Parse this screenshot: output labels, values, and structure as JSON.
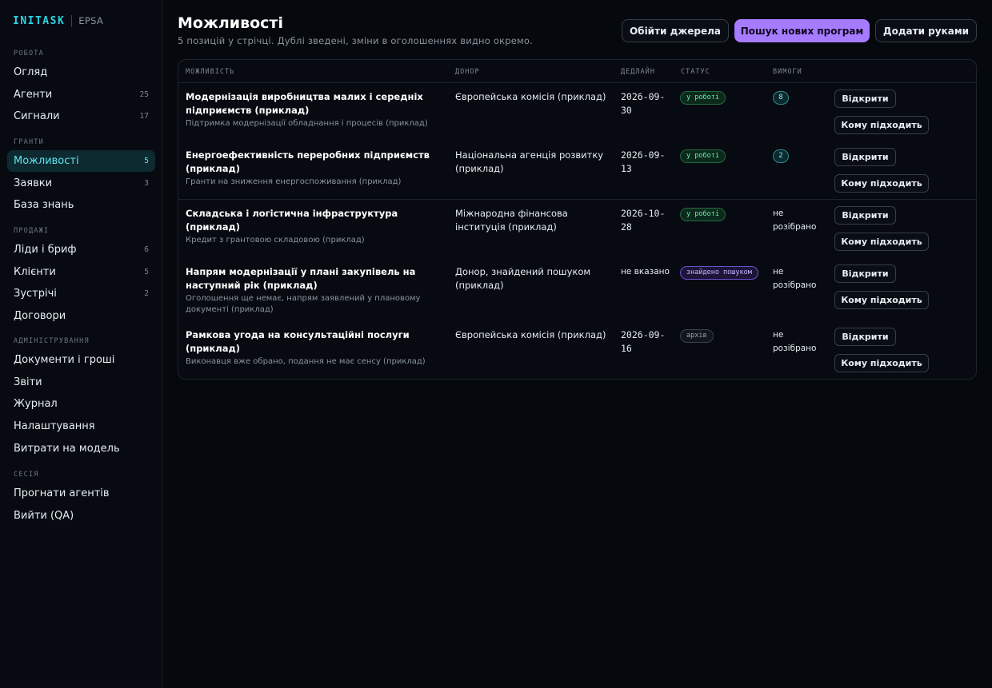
{
  "brand": {
    "logo": "INITASK",
    "org": "EPSA"
  },
  "sidebar": {
    "sections": [
      {
        "title": "РОБОТА",
        "items": [
          {
            "label": "Огляд",
            "count": ""
          },
          {
            "label": "Агенти",
            "count": "25"
          },
          {
            "label": "Сигнали",
            "count": "17"
          }
        ]
      },
      {
        "title": "ГРАНТИ",
        "items": [
          {
            "label": "Можливості",
            "count": "5",
            "active": true
          },
          {
            "label": "Заявки",
            "count": "3"
          },
          {
            "label": "База знань",
            "count": ""
          }
        ]
      },
      {
        "title": "ПРОДАЖІ",
        "items": [
          {
            "label": "Ліди і бриф",
            "count": "6"
          },
          {
            "label": "Клієнти",
            "count": "5"
          },
          {
            "label": "Зустрічі",
            "count": "2"
          },
          {
            "label": "Договори",
            "count": ""
          }
        ]
      },
      {
        "title": "АДМІНІСТРУВАННЯ",
        "items": [
          {
            "label": "Документи і гроші",
            "count": ""
          },
          {
            "label": "Звіти",
            "count": ""
          },
          {
            "label": "Журнал",
            "count": ""
          },
          {
            "label": "Налаштування",
            "count": ""
          },
          {
            "label": "Витрати на модель",
            "count": ""
          }
        ]
      },
      {
        "title": "СЕСІЯ",
        "items": [
          {
            "label": "Прогнати агентів",
            "count": ""
          },
          {
            "label": "Вийти (QA)",
            "count": ""
          }
        ]
      }
    ]
  },
  "header": {
    "title": "Можливості",
    "subtitle": "5 позицій у стрічці. Дублі зведені, зміни в оголошеннях видно окремо.",
    "buttons": {
      "bypass": "Обійти джерела",
      "search": "Пошук нових програм",
      "add": "Додати руками"
    }
  },
  "colors": {
    "accent": "#a77bff",
    "brand": "#2dd4e4",
    "active_nav": "#5ee4ef"
  },
  "table": {
    "columns": [
      "МОЖЛИВІСТЬ",
      "ДОНОР",
      "ДЕДЛАЙН",
      "СТАТУС",
      "ВИМОГИ"
    ],
    "open_label": "Відкрити",
    "fit_label": "Кому підходить",
    "rows": [
      {
        "title": "Модернізація виробництва малих і середніх підприємств (приклад)",
        "desc": "Підтримка модернізації обладнання і процесів (приклад)",
        "donor": "Європейська комісія (приклад)",
        "deadline": "2026-09-30",
        "status": "у роботі",
        "status_kind": "work",
        "req": "8"
      },
      {
        "title": "Енергоефективність переробних підприємств (приклад)",
        "desc": "Гранти на зниження енергоспоживання (приклад)",
        "donor": "Національна агенція розвитку (приклад)",
        "deadline": "2026-09-13",
        "status": "у роботі",
        "status_kind": "work",
        "req": "2"
      },
      {
        "title": "Складська і логістична інфраструктура (приклад)",
        "desc": "Кредит з грантовою складовою (приклад)",
        "donor": "Міжнародна фінансова інституція (приклад)",
        "deadline": "2026-10-28",
        "status": "у роботі",
        "status_kind": "work",
        "req": "не розібрано"
      },
      {
        "title": "Напрям модернізації у плані закупівель на наступний рік (приклад)",
        "desc": "Оголошення ще немає, напрям заявлений у плановому документі (приклад)",
        "donor": "Донор, знайдений пошуком (приклад)",
        "deadline": "не вказано",
        "status": "знайдено пошуком",
        "status_kind": "found",
        "req": "не розібрано"
      },
      {
        "title": "Рамкова угода на консультаційні послуги (приклад)",
        "desc": "Виконавця вже обрано, подання не має сенсу (приклад)",
        "donor": "Європейська комісія (приклад)",
        "deadline": "2026-09-16",
        "status": "архів",
        "status_kind": "archive",
        "req": "не розібрано"
      }
    ]
  }
}
